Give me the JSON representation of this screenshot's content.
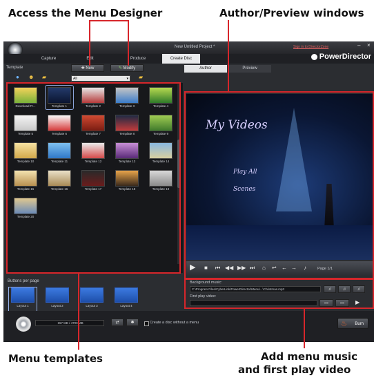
{
  "callouts": {
    "menu_designer": "Access the Menu Designer",
    "author_preview": "Author/Preview windows",
    "menu_templates": "Menu templates",
    "add_music_line1": "Add menu music",
    "add_music_line2": "and first play video"
  },
  "app": {
    "window_title": "New Untitled Project *",
    "sign_in": "Sign in to DirectorZone",
    "brand": "PowerDirector",
    "main_tabs": [
      "Capture",
      "Edit",
      "Produce",
      "Create Disc"
    ],
    "template_header": "Template",
    "new_button": "New",
    "modify_button": "Modify",
    "filter_value": "All",
    "author_tab": "Author",
    "preview_tab": "Preview",
    "templates": [
      "Download Fr...",
      "Template 1",
      "Template 2",
      "Template 3",
      "Template 4",
      "Template 5",
      "Template 6",
      "Template 7",
      "Template 8",
      "Template 9",
      "Template 10",
      "Template 11",
      "Template 12",
      "Template 13",
      "Template 14",
      "Template 15",
      "Template 16",
      "Template 17",
      "Template 18",
      "Template 19",
      "Template 20"
    ],
    "preview_title": "My Videos",
    "preview_play_all": "Play All",
    "preview_scenes": "Scenes",
    "page_indicator": "Page 1/1",
    "buttons_per_page": "Buttons per page",
    "layouts": [
      "Layout 1",
      "Layout 2",
      "Layout 3",
      "Layout 4"
    ],
    "background_music_label": "Background music:",
    "background_music_path": "C:\\Program Files\\CyberLink\\PowerDirector\\Menu\\...\\Christmas.mp3",
    "first_play_label": "First play video:",
    "disc_size": "157 MB / 4700 MB",
    "no_menu_checkbox_label": "Create a disc without a menu",
    "burn_button": "Burn"
  }
}
